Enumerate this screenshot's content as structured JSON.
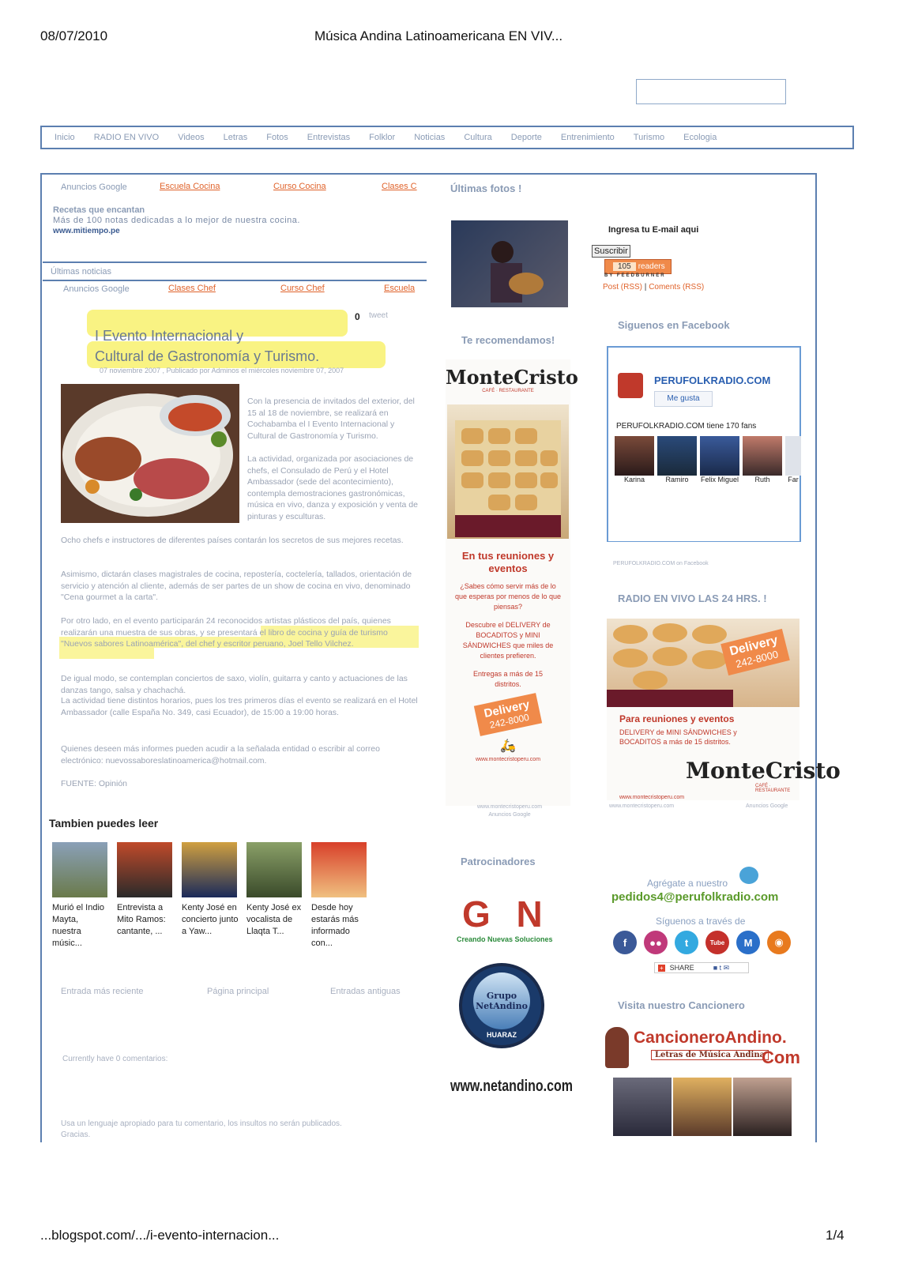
{
  "header": {
    "date": "08/07/2010",
    "title": "Música Andina Latinoamericana EN VIV..."
  },
  "footer": {
    "url": "...blogspot.com/.../i-evento-internacion...",
    "page": "1/4"
  },
  "nav": [
    "Inicio",
    "RADIO EN VIVO",
    "Videos",
    "Letras",
    "Fotos",
    "Entrevistas",
    "Folklor",
    "Noticias",
    "Cultura",
    "Deporte",
    "Entrenimiento",
    "Turismo",
    "Ecologia"
  ],
  "ads_top": {
    "label": "Anuncios Google",
    "links": [
      "Escuela Cocina",
      "Curso Cocina",
      "Clases C"
    ],
    "title": "Recetas que encantan",
    "desc": "Más de 100 notas dedicadas a lo mejor de nuestra cocina.",
    "url": "www.mitiempo.pe"
  },
  "ultimas_noticias": "Últimas noticias",
  "ads_second": {
    "label": "Anuncios Google",
    "links": [
      "Clases Chef",
      "Curso Chef",
      "Escuela"
    ]
  },
  "post": {
    "tweet_count": "0",
    "tweet_label": "tweet",
    "title_line1": "I Evento Internacional y",
    "title_line2": "Cultural de Gastronomía y Turismo.",
    "byline": "07 noviembre 2007 , Publicado por Adminos el miércoles noviembre 07, 2007",
    "col_text": "Con la presencia de invitados del exterior, del 15 al 18 de noviembre, se realizará en Cochabamba el I Evento Internacional y Cultural de Gastronomía y Turismo.",
    "col_text2": "La actividad, organizada por asociaciones de chefs, el Consulado de Perú y el Hotel Ambassador (sede del acontecimiento), contempla demostraciones gastronómicas, música en vivo, danza y exposición y venta de pinturas y esculturas.",
    "p1": "Ocho chefs e instructores de diferentes países contarán los secretos de sus mejores recetas.",
    "p2": "Asimismo, dictarán clases magistrales de cocina, repostería, coctelería, tallados, orientación de servicio y atención al cliente, además de ser partes de un show de cocina en vivo, denominado \"Cena gourmet a la carta\".",
    "p3a": "Por otro lado, en el evento participarán 24 reconocidos artistas plásticos del país, quienes realizarán una muestra de sus obras, y ",
    "p3b": "se presentará el libro de cocina y guía de turismo \"Nuevos sabores Latinoamérica\", del chef y escritor peruano, Joel Tello Vilchez.",
    "p4": "De igual modo, se contemplan conciertos de saxo, violín, guitarra y canto y actuaciones de las danzas tango, salsa y chachachá.",
    "p5": "La actividad tiene distintos horarios, pues los tres primeros días el evento se realizará en el Hotel Ambassador (calle España No. 349, casi Ecuador), de 15:00 a 19:00 horas.",
    "p6": "Quienes deseen más informes pueden acudir a la señalada entidad o escribir al correo electrónico: nuevossaboreslatinoamerica@hotmail.com.",
    "source": "FUENTE: Opinión"
  },
  "also_read": {
    "title": "Tambien puedes leer",
    "items": [
      "Murió el Indio Mayta, nuestra músic...",
      "Entrevista a Mito Ramos: cantante, ...",
      "Kenty José en concierto junto a Yaw...",
      "Kenty José ex vocalista de Llaqta T...",
      "Desde hoy estarás más informado con..."
    ]
  },
  "pager": {
    "newer": "Entrada más reciente",
    "home": "Página principal",
    "older": "Entradas antiguas"
  },
  "comments_count": "Currently have 0 comentarios:",
  "comment_note": "Usa un lenguaje apropiado para tu comentario, los insultos no serán publicados. Gracias.",
  "middle": {
    "ultimas_fotos": "Últimas fotos !",
    "recomendamos": "Te recomendamos!",
    "ad": {
      "brand": "MonteCristo",
      "brand_sub": "CAFÉ · RESTAURANTE",
      "headline": "En tus reuniones y eventos",
      "q": "¿Sabes cómo servir más de lo que esperas por menos de lo que piensas?",
      "desc": "Descubre el DELIVERY de BOCADITOS y MINI SÁNDWICHES que miles de clientes prefieren.",
      "reach": "Entregas a más de 15 distritos.",
      "delivery": "Delivery",
      "phone": "242-8000",
      "url": "www.montecristoperu.com",
      "url2": "www.montecristoperu.com",
      "google": "Anuncios Google"
    },
    "patrocinadores": "Patrocinadores",
    "gn_logo": "G N",
    "gn_tagline": "Creando Nuevas Soluciones",
    "netandino_badge": "Grupo NetAndino",
    "netandino_city": "HUARAZ",
    "netandino_url": "www.netandino.com"
  },
  "right": {
    "email_label": "Ingresa tu E-mail aqui",
    "subscribe": "Suscribir",
    "readers": "105",
    "readers_label": "readers",
    "feedburner": "BY FEEDBURNER",
    "post_rss": "Post (RSS)",
    "comments_rss": "Coments (RSS)",
    "siguenos_fb": "Siguenos en Facebook",
    "fb_page": "PERUFOLKRADIO.COM",
    "fb_like": "Me gusta",
    "fb_fans": "PERUFOLKRADIO.COM tiene 170 fans",
    "fans": [
      "Karina",
      "Ramiro",
      "Felix Miguel",
      "Ruth",
      "Far"
    ],
    "fb_footer": "PERUFOLKRADIO.COM on Facebook",
    "radio_title": "RADIO EN VIVO LAS 24 HRS. !",
    "ad2": {
      "delivery": "Delivery",
      "phone": "242-8000",
      "headline": "Para reuniones y eventos",
      "desc": "DELIVERY de MINI SÁNDWICHES y BOCADITOS a más de 15 distritos.",
      "brand": "MonteCristo",
      "brand_sub": "CAFÉ · RESTAURANTE",
      "url": "www.montecristoperu.com",
      "url2": "www.montecristoperu.com",
      "google": "Anuncios Google"
    },
    "agregate": "Agrégate a nuestro",
    "email_contact": "pedidos4@perufolkradio.com",
    "siguenos_traves": "Síguenos a través de",
    "social": [
      {
        "name": "facebook-icon",
        "glyph": "f",
        "color": "#3b5998"
      },
      {
        "name": "flickr-icon",
        "glyph": "●●",
        "color": "#c0397a"
      },
      {
        "name": "twitter-icon",
        "glyph": "t",
        "color": "#33a9e0"
      },
      {
        "name": "youtube-icon",
        "glyph": "Tube",
        "color": "#c4302b"
      },
      {
        "name": "myspace-icon",
        "glyph": "M",
        "color": "#2a6fc9"
      },
      {
        "name": "rss-icon",
        "glyph": "◉",
        "color": "#e87a1e"
      }
    ],
    "share": "SHARE",
    "cancionero_title": "Visita nuestro Cancionero",
    "cancionero_brand": "CancioneroAndino.",
    "cancionero_com": "Com",
    "cancionero_sub": "Letras de Música Andina"
  }
}
